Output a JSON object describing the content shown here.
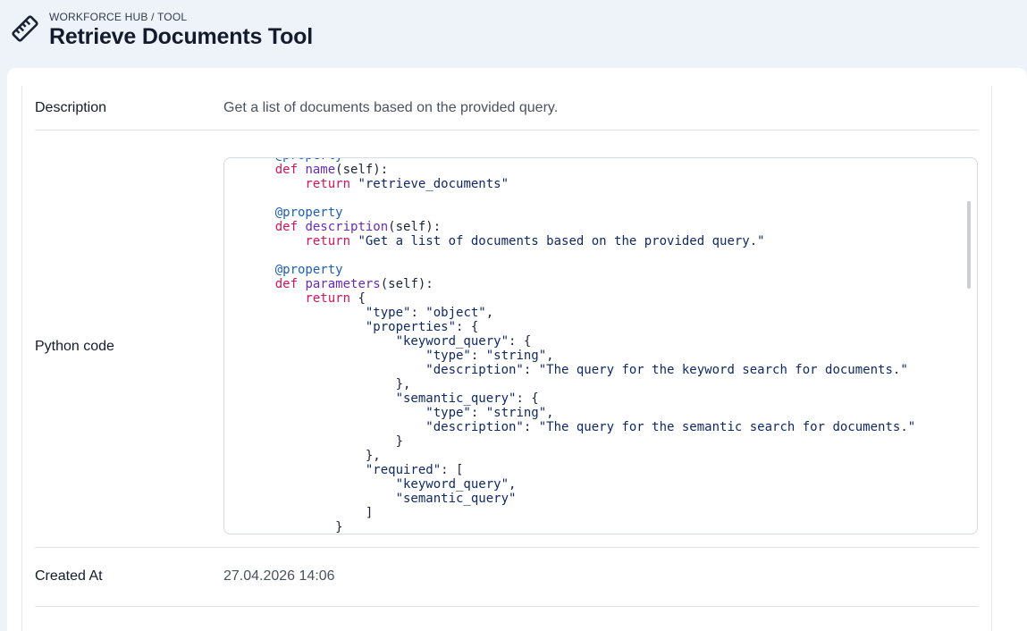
{
  "header": {
    "breadcrumb": "WORKFORCE HUB / TOOL",
    "title": "Retrieve Documents Tool",
    "icon": "ruler-icon"
  },
  "details": {
    "description": {
      "label": "Description",
      "value": "Get a list of documents based on the provided query."
    },
    "python_code": {
      "label": "Python code"
    },
    "created_at": {
      "label": "Created At",
      "value": "27.04.2026 14:06"
    }
  },
  "code": {
    "lines": [
      [
        [
          "dec",
          "    @property"
        ]
      ],
      [
        [
          "kw",
          "    def "
        ],
        [
          "fn",
          "name"
        ],
        [
          "plain",
          "(self):"
        ]
      ],
      [
        [
          "kw",
          "        return "
        ],
        [
          "str",
          "\"retrieve_documents\""
        ]
      ],
      [
        [
          "plain",
          ""
        ]
      ],
      [
        [
          "dec",
          "    @property"
        ]
      ],
      [
        [
          "kw",
          "    def "
        ],
        [
          "fn",
          "description"
        ],
        [
          "plain",
          "(self):"
        ]
      ],
      [
        [
          "kw",
          "        return "
        ],
        [
          "str",
          "\"Get a list of documents based on the provided query.\""
        ]
      ],
      [
        [
          "plain",
          ""
        ]
      ],
      [
        [
          "dec",
          "    @property"
        ]
      ],
      [
        [
          "kw",
          "    def "
        ],
        [
          "fn",
          "parameters"
        ],
        [
          "plain",
          "(self):"
        ]
      ],
      [
        [
          "kw",
          "        return "
        ],
        [
          "plain",
          "{"
        ]
      ],
      [
        [
          "str",
          "                \"type\""
        ],
        [
          "plain",
          ": "
        ],
        [
          "str",
          "\"object\""
        ],
        [
          "plain",
          ","
        ]
      ],
      [
        [
          "str",
          "                \"properties\""
        ],
        [
          "plain",
          ": {"
        ]
      ],
      [
        [
          "str",
          "                    \"keyword_query\""
        ],
        [
          "plain",
          ": {"
        ]
      ],
      [
        [
          "str",
          "                        \"type\""
        ],
        [
          "plain",
          ": "
        ],
        [
          "str",
          "\"string\""
        ],
        [
          "plain",
          ","
        ]
      ],
      [
        [
          "str",
          "                        \"description\""
        ],
        [
          "plain",
          ": "
        ],
        [
          "str",
          "\"The query for the keyword search for documents.\""
        ]
      ],
      [
        [
          "plain",
          "                    },"
        ]
      ],
      [
        [
          "str",
          "                    \"semantic_query\""
        ],
        [
          "plain",
          ": {"
        ]
      ],
      [
        [
          "str",
          "                        \"type\""
        ],
        [
          "plain",
          ": "
        ],
        [
          "str",
          "\"string\""
        ],
        [
          "plain",
          ","
        ]
      ],
      [
        [
          "str",
          "                        \"description\""
        ],
        [
          "plain",
          ": "
        ],
        [
          "str",
          "\"The query for the semantic search for documents.\""
        ]
      ],
      [
        [
          "plain",
          "                    }"
        ]
      ],
      [
        [
          "plain",
          "                },"
        ]
      ],
      [
        [
          "str",
          "                \"required\""
        ],
        [
          "plain",
          ": ["
        ]
      ],
      [
        [
          "str",
          "                    \"keyword_query\""
        ],
        [
          "plain",
          ","
        ]
      ],
      [
        [
          "str",
          "                    \"semantic_query\""
        ]
      ],
      [
        [
          "plain",
          "                ]"
        ]
      ],
      [
        [
          "plain",
          "            }"
        ]
      ]
    ]
  },
  "colors": {
    "keyword": "#d4145a",
    "function": "#6a2bb8",
    "decorator": "#1d5fb4",
    "string": "#0f2a63"
  }
}
